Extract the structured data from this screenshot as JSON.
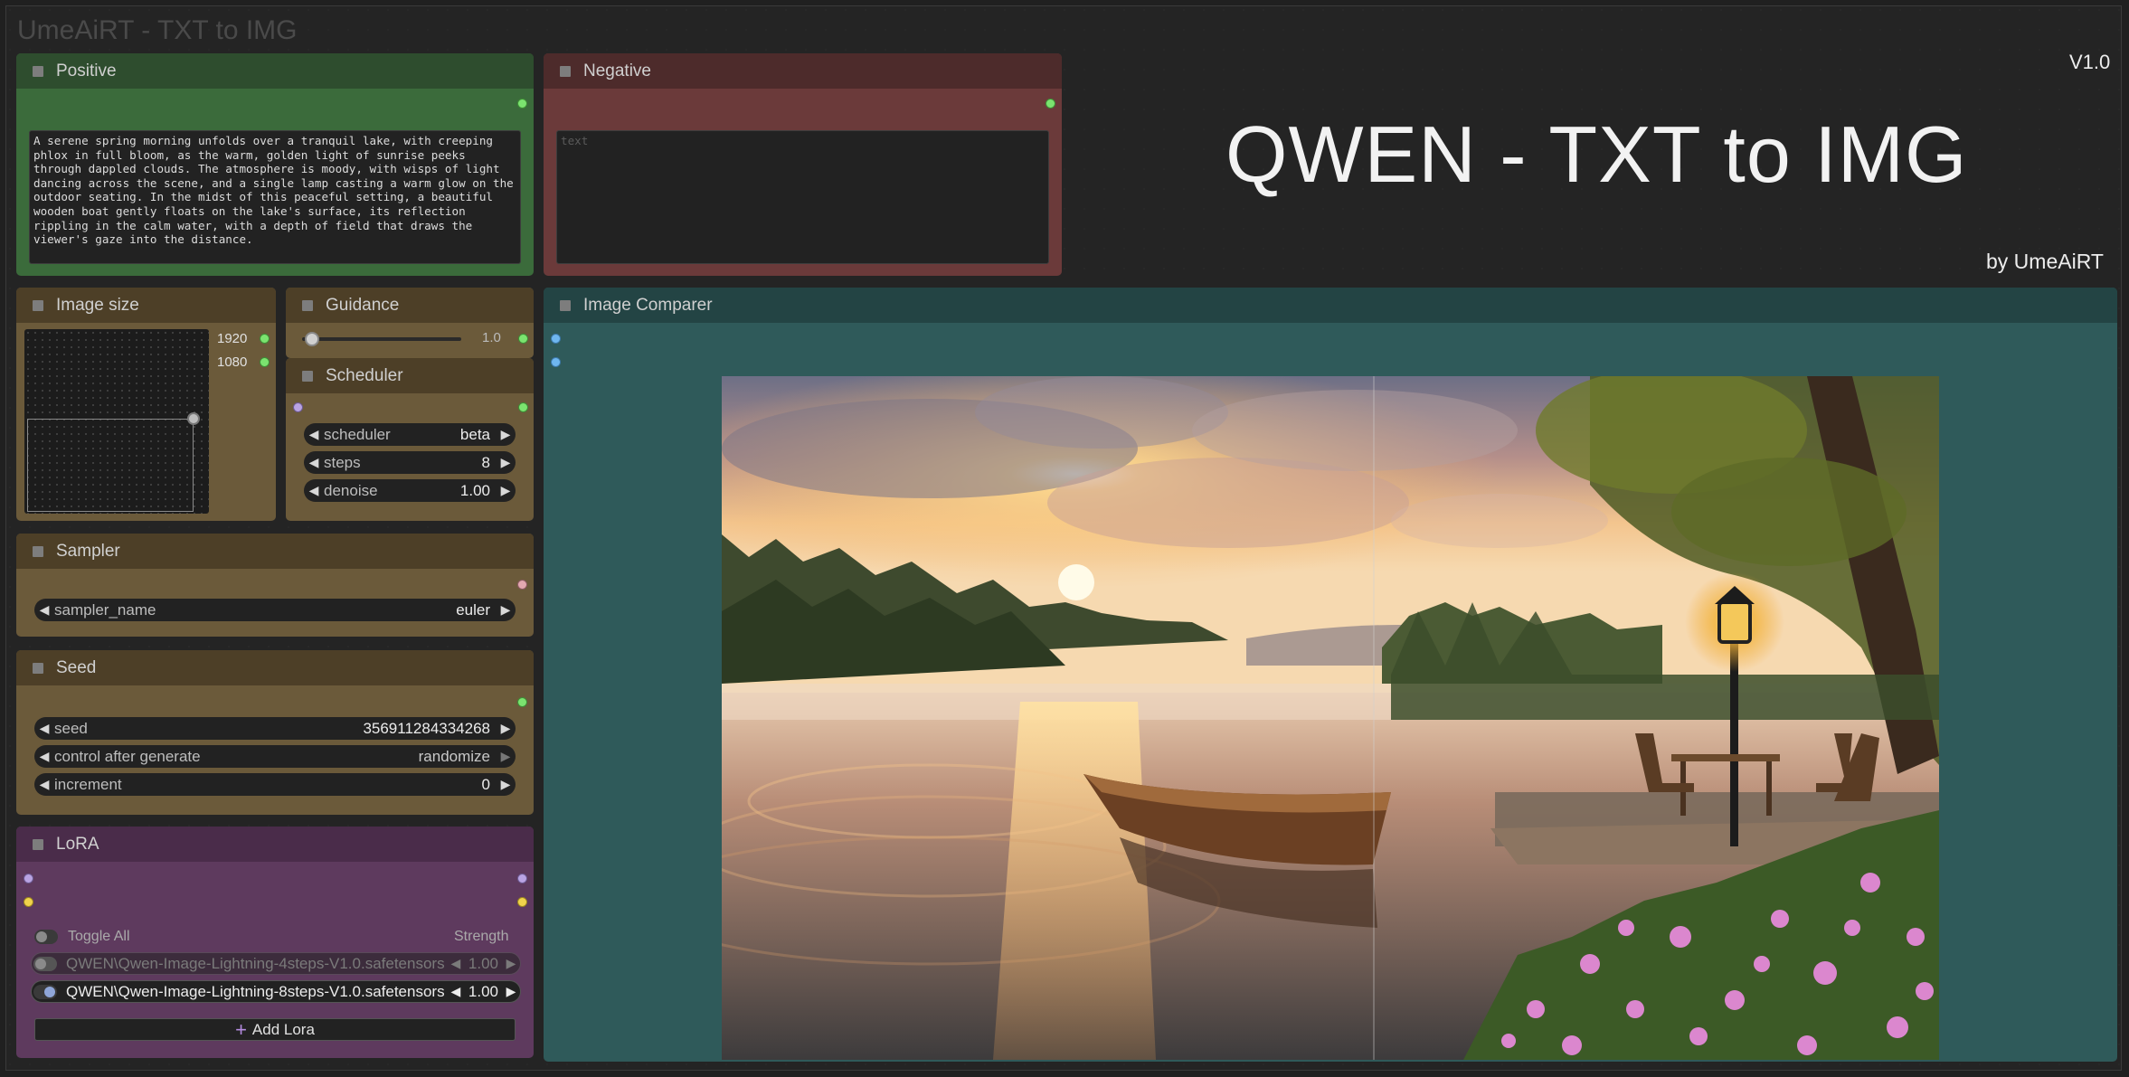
{
  "workflow": {
    "group_title": "UmeAiRT - TXT to IMG",
    "banner_title": "QWEN - TXT to IMG",
    "version": "V1.0",
    "author": "by UmeAiRT"
  },
  "positive": {
    "title": "Positive",
    "text": "A serene spring morning unfolds over a tranquil lake, with creeping phlox in full bloom, as the warm, golden light of sunrise peeks through dappled clouds. The atmosphere is moody, with wisps of light dancing across the scene, and a single lamp casting a warm glow on the outdoor seating. In the midst of this peaceful setting, a beautiful wooden boat gently floats on the lake's surface, its reflection rippling in the calm water, with a depth of field that draws the viewer's gaze into the distance."
  },
  "negative": {
    "title": "Negative",
    "placeholder": "text"
  },
  "image_size": {
    "title": "Image size",
    "width": "1920",
    "height": "1080"
  },
  "guidance": {
    "title": "Guidance",
    "value": "1.0",
    "level": 0.05
  },
  "scheduler": {
    "title": "Scheduler",
    "scheduler_label": "scheduler",
    "scheduler_value": "beta",
    "steps_label": "steps",
    "steps_value": "8",
    "denoise_label": "denoise",
    "denoise_value": "1.00"
  },
  "sampler": {
    "title": "Sampler",
    "name_label": "sampler_name",
    "name_value": "euler"
  },
  "seed": {
    "title": "Seed",
    "seed_label": "seed",
    "seed_value": "356911284334268",
    "control_label": "control after generate",
    "control_value": "randomize",
    "increment_label": "increment",
    "increment_value": "0"
  },
  "lora": {
    "title": "LoRA",
    "toggle_all_label": "Toggle All",
    "strength_label": "Strength",
    "items": [
      {
        "name": "QWEN\\Qwen-Image-Lightning-4steps-V1.0.safetensors",
        "strength": "1.00",
        "enabled": false
      },
      {
        "name": "QWEN\\Qwen-Image-Lightning-8steps-V1.0.safetensors",
        "strength": "1.00",
        "enabled": true
      }
    ],
    "add_label": "Add Lora"
  },
  "comparer": {
    "title": "Image Comparer",
    "split": 0.536
  },
  "colors": {
    "positive_header": "#2e4d2e",
    "negative_header": "#4d2b2b",
    "panel_brown": "#6b5a3a",
    "lora_purple": "#5e3a5e",
    "comparer_teal": "#2f5a5a"
  }
}
